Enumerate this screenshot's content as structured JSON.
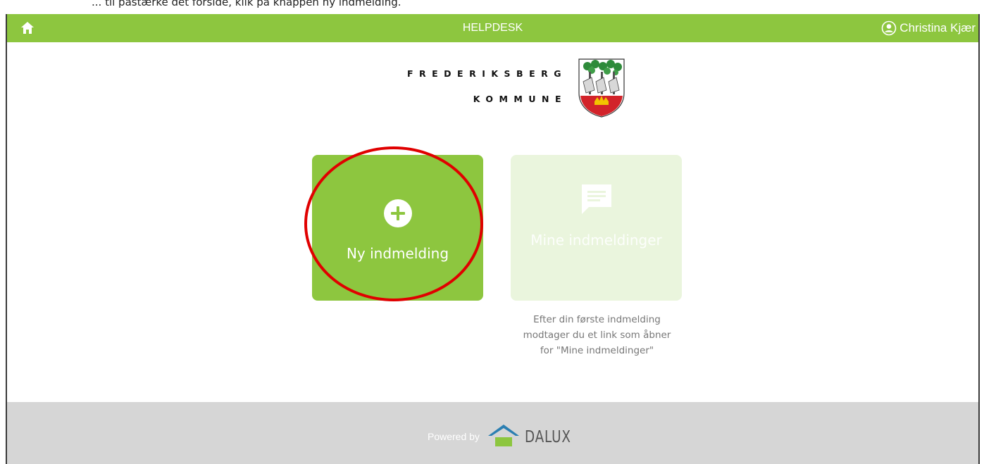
{
  "top_strip": {
    "text": "... til påstærke det forside, klik på knappen ny indmelding."
  },
  "header": {
    "title": "HELPDESK",
    "user_name": "Christina Kjær",
    "icons": {
      "home": "home-icon",
      "user": "user-circle-icon"
    },
    "color": "#8dc63f"
  },
  "logo": {
    "line1": "FREDERIKSBERG",
    "line2": "KOMMUNE",
    "crest": "frederiksberg-crest"
  },
  "tiles": [
    {
      "label": "Ny indmelding",
      "icon": "plus-circle-icon",
      "enabled": true
    },
    {
      "label": "Mine indmeldinger",
      "icon": "chat-icon",
      "enabled": false
    }
  ],
  "note": {
    "line1": "Efter din første indmelding",
    "line2": "modtager du et link som åbner",
    "line3": "for \"Mine indmeldinger\""
  },
  "footer": {
    "powered_by": "Powered by",
    "brand": "DALUX",
    "brand_icon": "dalux-house-icon"
  },
  "annotation": {
    "shape": "circle",
    "color": "#e00000",
    "target": "Ny indmelding"
  }
}
